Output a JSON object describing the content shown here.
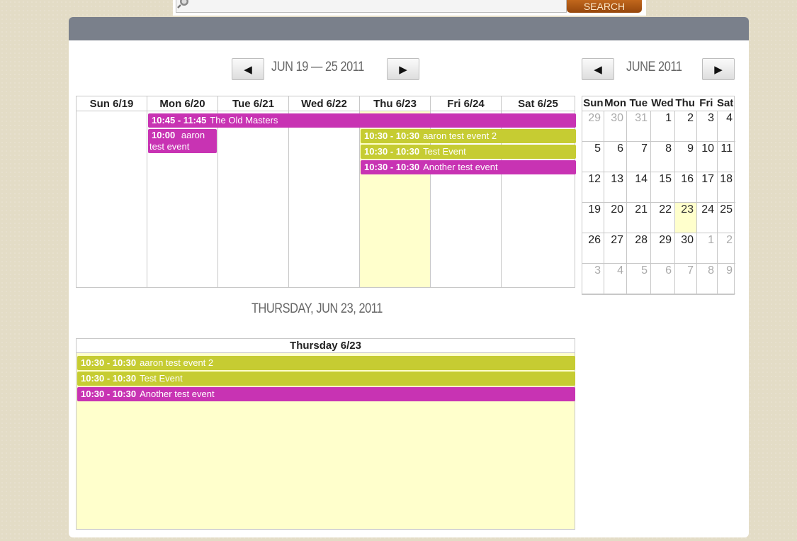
{
  "search": {
    "button_label": "SEARCH",
    "placeholder": ""
  },
  "week_view": {
    "prev_label": "◀",
    "next_label": "▶",
    "range_title": "JUN 19 — 25 2011",
    "days": [
      "Sun 6/19",
      "Mon 6/20",
      "Tue 6/21",
      "Wed 6/22",
      "Thu 6/23",
      "Fri 6/24",
      "Sat 6/25"
    ],
    "events": [
      {
        "time": "10:45 - 11:45",
        "title": "The Old Masters",
        "color": "#c833b3"
      },
      {
        "time": "10:00",
        "title": "aaron test event",
        "color": "#c833b3"
      },
      {
        "time": "10:30 - 10:30",
        "title": "aaron test event 2",
        "color": "#c6cc32"
      },
      {
        "time": "10:30 - 10:30",
        "title": "Test Event",
        "color": "#c6cc32"
      },
      {
        "time": "10:30 - 10:30",
        "title": "Another test event",
        "color": "#c833b3"
      }
    ]
  },
  "day_view": {
    "title": "THURSDAY, JUN 23, 2011",
    "header": "Thursday 6/23",
    "events": [
      {
        "time": "10:30 - 10:30",
        "title": "aaron test event 2",
        "color": "#c6cc32"
      },
      {
        "time": "10:30 - 10:30",
        "title": "Test Event",
        "color": "#c6cc32"
      },
      {
        "time": "10:30 - 10:30",
        "title": "Another test event",
        "color": "#c833b3"
      }
    ]
  },
  "mini_calendar": {
    "prev_label": "◀",
    "next_label": "▶",
    "title": "JUNE 2011",
    "weekdays": [
      "Sun",
      "Mon",
      "Tue",
      "Wed",
      "Thu",
      "Fri",
      "Sat"
    ],
    "weeks": [
      [
        "29",
        "30",
        "31",
        "1",
        "2",
        "3",
        "4"
      ],
      [
        "5",
        "6",
        "7",
        "8",
        "9",
        "10",
        "11"
      ],
      [
        "12",
        "13",
        "14",
        "15",
        "16",
        "17",
        "18"
      ],
      [
        "19",
        "20",
        "21",
        "22",
        "23",
        "24",
        "25"
      ],
      [
        "26",
        "27",
        "28",
        "29",
        "30",
        "1",
        "2"
      ],
      [
        "3",
        "4",
        "5",
        "6",
        "7",
        "8",
        "9"
      ]
    ],
    "today": "23"
  },
  "colors": {
    "highlight": "#ffffcc",
    "header_bar": "#7a808b",
    "event_magenta": "#c833b3",
    "event_olive": "#c6cc32"
  }
}
